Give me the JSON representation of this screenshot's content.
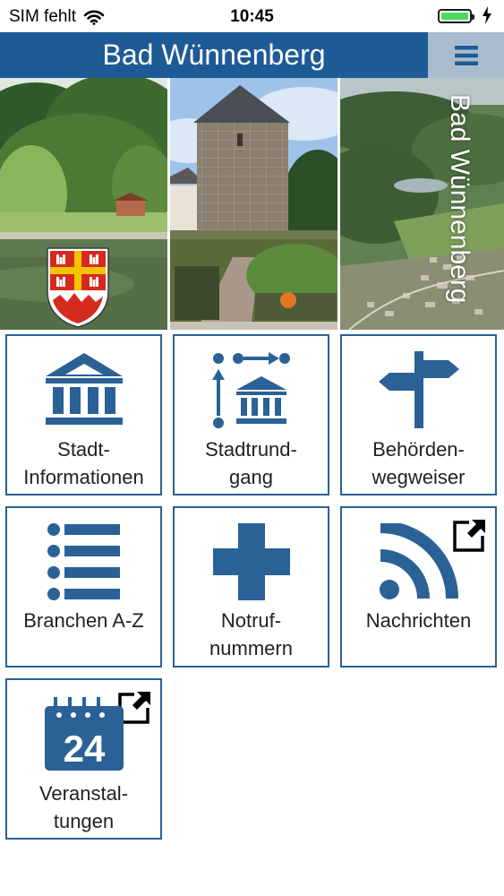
{
  "status": {
    "carrier": "SIM fehlt",
    "time": "10:45",
    "battery_level": 1.0
  },
  "header": {
    "title": "Bad Wünnenberg",
    "menu_icon": "hamburger-menu-icon"
  },
  "banner": {
    "overlay_text": "Bad Wünnenberg"
  },
  "tiles": [
    {
      "label": "Stadt-\nInformationen",
      "icon": "town-hall-icon",
      "external": false
    },
    {
      "label": "Stadtrund-\ngang",
      "icon": "city-tour-route-icon",
      "external": false
    },
    {
      "label": "Behörden-\nwegweiser",
      "icon": "signpost-icon",
      "external": false
    },
    {
      "label": "Branchen A-Z",
      "icon": "list-icon",
      "external": false
    },
    {
      "label": "Notruf-\nnummern",
      "icon": "medical-cross-icon",
      "external": false
    },
    {
      "label": "Nachrichten",
      "icon": "rss-feed-icon",
      "external": true
    },
    {
      "label": "Veranstal-\ntungen",
      "icon": "calendar-icon",
      "external": true,
      "calendar_day": "24"
    }
  ],
  "colors": {
    "primary": "#1e5a96",
    "icon": "#2a6196",
    "menu_bg": "#a9bccf",
    "tile_border": "#2a6196"
  }
}
